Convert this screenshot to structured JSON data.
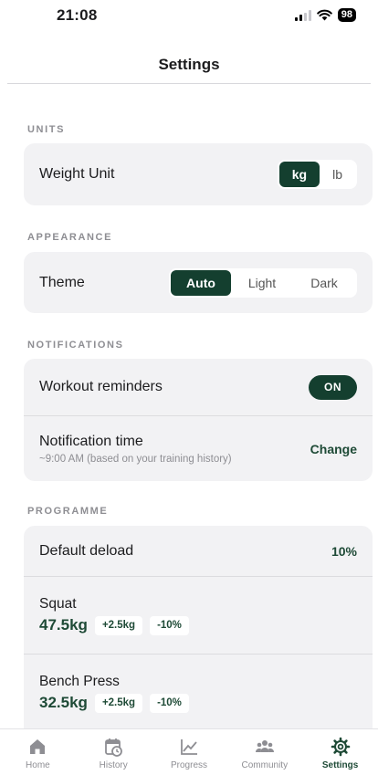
{
  "status_bar": {
    "time": "21:08",
    "battery": "98"
  },
  "header": {
    "title": "Settings"
  },
  "sections": {
    "units": {
      "label": "UNITS",
      "weight_unit": {
        "label": "Weight Unit",
        "options": [
          "kg",
          "lb"
        ],
        "selected": "kg"
      }
    },
    "appearance": {
      "label": "APPEARANCE",
      "theme": {
        "label": "Theme",
        "options": [
          "Auto",
          "Light",
          "Dark"
        ],
        "selected": "Auto"
      }
    },
    "notifications": {
      "label": "NOTIFICATIONS",
      "workout_reminders": {
        "label": "Workout reminders",
        "state": "ON"
      },
      "notification_time": {
        "label": "Notification time",
        "subtitle": "~9:00 AM (based on your training history)",
        "action": "Change"
      }
    },
    "programme": {
      "label": "PROGRAMME",
      "default_deload": {
        "label": "Default deload",
        "value": "10%"
      },
      "exercises": [
        {
          "name": "Squat",
          "weight": "47.5kg",
          "increment": "+2.5kg",
          "deload": "-10%"
        },
        {
          "name": "Bench Press",
          "weight": "32.5kg",
          "increment": "+2.5kg",
          "deload": "-10%"
        }
      ]
    }
  },
  "tab_bar": {
    "items": [
      {
        "label": "Home",
        "icon": "home-icon"
      },
      {
        "label": "History",
        "icon": "calendar-clock-icon"
      },
      {
        "label": "Progress",
        "icon": "chart-line-icon"
      },
      {
        "label": "Community",
        "icon": "people-icon"
      },
      {
        "label": "Settings",
        "icon": "gear-icon"
      }
    ],
    "active": "Settings"
  },
  "colors": {
    "accent": "#143f2f",
    "accent_text": "#1e4a36",
    "card_bg": "#f2f2f4",
    "muted": "#8e8e93"
  }
}
